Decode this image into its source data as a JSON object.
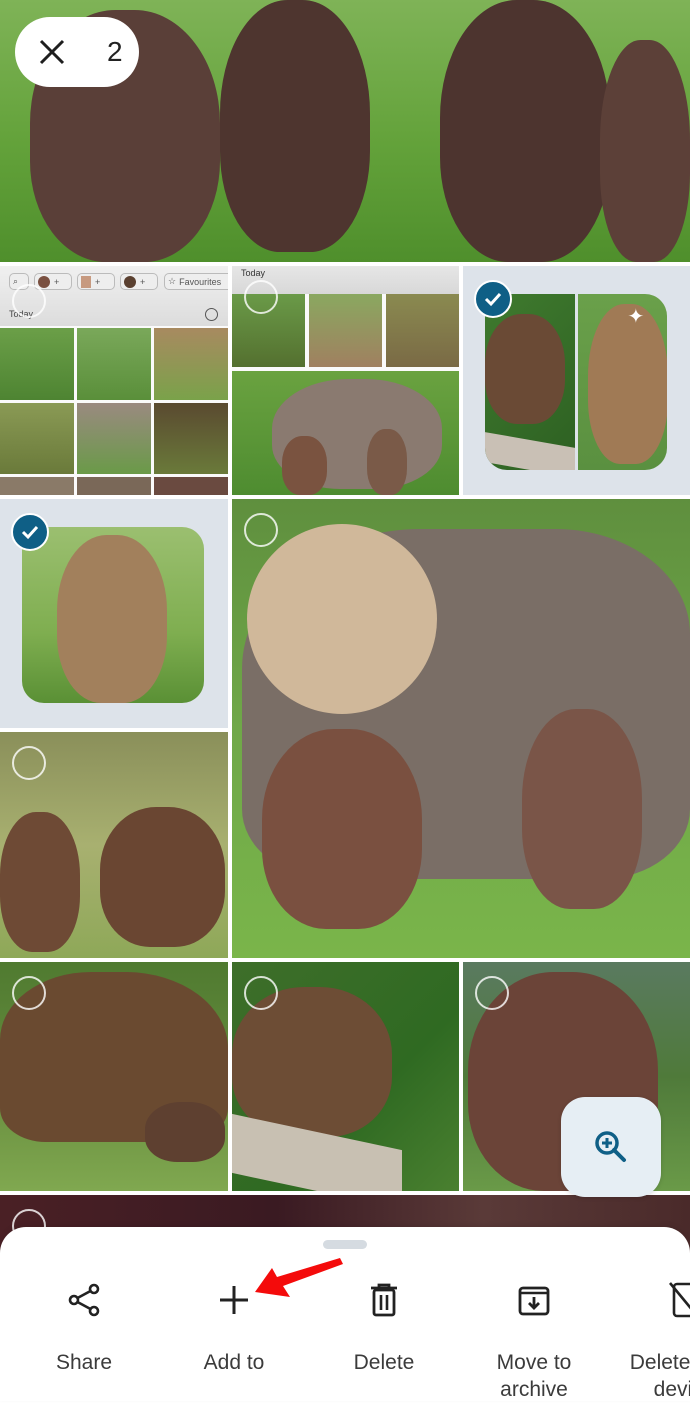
{
  "selection_bar": {
    "close_icon": "close-icon",
    "selected_count": "2"
  },
  "grid": {
    "screenshot_tile_1": {
      "chips": [
        "+",
        "+",
        "+"
      ],
      "favourites_label": "Favourites",
      "section_label": "Today"
    },
    "screenshot_tile_2": {
      "section_label": "Today"
    },
    "photos": [
      {
        "id": "bear-cubs-holding-hands",
        "selected": false
      },
      {
        "id": "app-screenshot-grid",
        "selected": false
      },
      {
        "id": "app-screenshot-today",
        "selected": false
      },
      {
        "id": "bear-collage",
        "selected": true
      },
      {
        "id": "standing-cub",
        "selected": true
      },
      {
        "id": "mother-bear-with-cubs",
        "selected": false
      },
      {
        "id": "cubs-playing",
        "selected": false
      },
      {
        "id": "bear-grazing-with-cub",
        "selected": false
      },
      {
        "id": "bear-on-rock",
        "selected": false
      },
      {
        "id": "bear-sitting",
        "selected": false
      },
      {
        "id": "dark-photo",
        "selected": false
      }
    ]
  },
  "zoom_button": {
    "icon": "zoom-in-icon"
  },
  "action_sheet": {
    "actions": [
      {
        "label": "Share",
        "icon": "share-icon"
      },
      {
        "label": "Add to",
        "icon": "plus-icon"
      },
      {
        "label": "Delete",
        "icon": "trash-icon"
      },
      {
        "label": "Move to archive",
        "icon": "archive-icon"
      },
      {
        "label": "Delete from device",
        "icon": "delete-device-icon"
      }
    ],
    "labels_visible": [
      "Share",
      "Add to",
      "Delete",
      "Move to\narchive",
      "Delete\ndevi"
    ]
  },
  "annotation": {
    "arrow_color": "#f40b0b",
    "points_to": "Add to"
  },
  "colors": {
    "check_blue": "#0f5f86",
    "selected_bg": "#dde3ea",
    "zoom_fab_bg": "#e6eef4",
    "grass": "#6aa840",
    "bear_brown": "#6b4a35"
  }
}
